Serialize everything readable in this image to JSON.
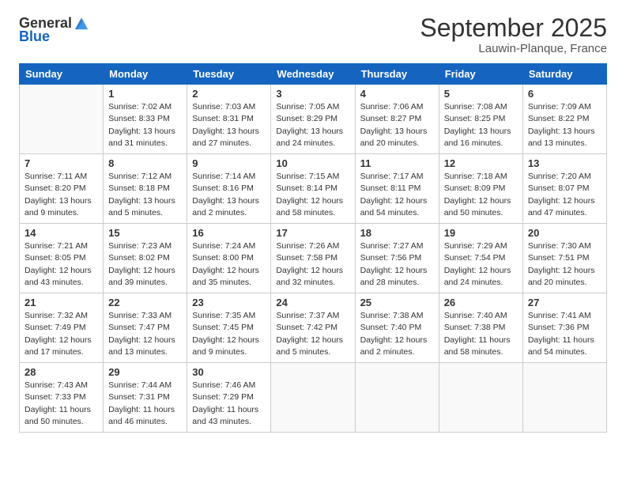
{
  "header": {
    "logo_general": "General",
    "logo_blue": "Blue",
    "month_title": "September 2025",
    "location": "Lauwin-Planque, France"
  },
  "days_of_week": [
    "Sunday",
    "Monday",
    "Tuesday",
    "Wednesday",
    "Thursday",
    "Friday",
    "Saturday"
  ],
  "weeks": [
    [
      {
        "day": "",
        "info": ""
      },
      {
        "day": "1",
        "info": "Sunrise: 7:02 AM\nSunset: 8:33 PM\nDaylight: 13 hours\nand 31 minutes."
      },
      {
        "day": "2",
        "info": "Sunrise: 7:03 AM\nSunset: 8:31 PM\nDaylight: 13 hours\nand 27 minutes."
      },
      {
        "day": "3",
        "info": "Sunrise: 7:05 AM\nSunset: 8:29 PM\nDaylight: 13 hours\nand 24 minutes."
      },
      {
        "day": "4",
        "info": "Sunrise: 7:06 AM\nSunset: 8:27 PM\nDaylight: 13 hours\nand 20 minutes."
      },
      {
        "day": "5",
        "info": "Sunrise: 7:08 AM\nSunset: 8:25 PM\nDaylight: 13 hours\nand 16 minutes."
      },
      {
        "day": "6",
        "info": "Sunrise: 7:09 AM\nSunset: 8:22 PM\nDaylight: 13 hours\nand 13 minutes."
      }
    ],
    [
      {
        "day": "7",
        "info": "Sunrise: 7:11 AM\nSunset: 8:20 PM\nDaylight: 13 hours\nand 9 minutes."
      },
      {
        "day": "8",
        "info": "Sunrise: 7:12 AM\nSunset: 8:18 PM\nDaylight: 13 hours\nand 5 minutes."
      },
      {
        "day": "9",
        "info": "Sunrise: 7:14 AM\nSunset: 8:16 PM\nDaylight: 13 hours\nand 2 minutes."
      },
      {
        "day": "10",
        "info": "Sunrise: 7:15 AM\nSunset: 8:14 PM\nDaylight: 12 hours\nand 58 minutes."
      },
      {
        "day": "11",
        "info": "Sunrise: 7:17 AM\nSunset: 8:11 PM\nDaylight: 12 hours\nand 54 minutes."
      },
      {
        "day": "12",
        "info": "Sunrise: 7:18 AM\nSunset: 8:09 PM\nDaylight: 12 hours\nand 50 minutes."
      },
      {
        "day": "13",
        "info": "Sunrise: 7:20 AM\nSunset: 8:07 PM\nDaylight: 12 hours\nand 47 minutes."
      }
    ],
    [
      {
        "day": "14",
        "info": "Sunrise: 7:21 AM\nSunset: 8:05 PM\nDaylight: 12 hours\nand 43 minutes."
      },
      {
        "day": "15",
        "info": "Sunrise: 7:23 AM\nSunset: 8:02 PM\nDaylight: 12 hours\nand 39 minutes."
      },
      {
        "day": "16",
        "info": "Sunrise: 7:24 AM\nSunset: 8:00 PM\nDaylight: 12 hours\nand 35 minutes."
      },
      {
        "day": "17",
        "info": "Sunrise: 7:26 AM\nSunset: 7:58 PM\nDaylight: 12 hours\nand 32 minutes."
      },
      {
        "day": "18",
        "info": "Sunrise: 7:27 AM\nSunset: 7:56 PM\nDaylight: 12 hours\nand 28 minutes."
      },
      {
        "day": "19",
        "info": "Sunrise: 7:29 AM\nSunset: 7:54 PM\nDaylight: 12 hours\nand 24 minutes."
      },
      {
        "day": "20",
        "info": "Sunrise: 7:30 AM\nSunset: 7:51 PM\nDaylight: 12 hours\nand 20 minutes."
      }
    ],
    [
      {
        "day": "21",
        "info": "Sunrise: 7:32 AM\nSunset: 7:49 PM\nDaylight: 12 hours\nand 17 minutes."
      },
      {
        "day": "22",
        "info": "Sunrise: 7:33 AM\nSunset: 7:47 PM\nDaylight: 12 hours\nand 13 minutes."
      },
      {
        "day": "23",
        "info": "Sunrise: 7:35 AM\nSunset: 7:45 PM\nDaylight: 12 hours\nand 9 minutes."
      },
      {
        "day": "24",
        "info": "Sunrise: 7:37 AM\nSunset: 7:42 PM\nDaylight: 12 hours\nand 5 minutes."
      },
      {
        "day": "25",
        "info": "Sunrise: 7:38 AM\nSunset: 7:40 PM\nDaylight: 12 hours\nand 2 minutes."
      },
      {
        "day": "26",
        "info": "Sunrise: 7:40 AM\nSunset: 7:38 PM\nDaylight: 11 hours\nand 58 minutes."
      },
      {
        "day": "27",
        "info": "Sunrise: 7:41 AM\nSunset: 7:36 PM\nDaylight: 11 hours\nand 54 minutes."
      }
    ],
    [
      {
        "day": "28",
        "info": "Sunrise: 7:43 AM\nSunset: 7:33 PM\nDaylight: 11 hours\nand 50 minutes."
      },
      {
        "day": "29",
        "info": "Sunrise: 7:44 AM\nSunset: 7:31 PM\nDaylight: 11 hours\nand 46 minutes."
      },
      {
        "day": "30",
        "info": "Sunrise: 7:46 AM\nSunset: 7:29 PM\nDaylight: 11 hours\nand 43 minutes."
      },
      {
        "day": "",
        "info": ""
      },
      {
        "day": "",
        "info": ""
      },
      {
        "day": "",
        "info": ""
      },
      {
        "day": "",
        "info": ""
      }
    ]
  ]
}
